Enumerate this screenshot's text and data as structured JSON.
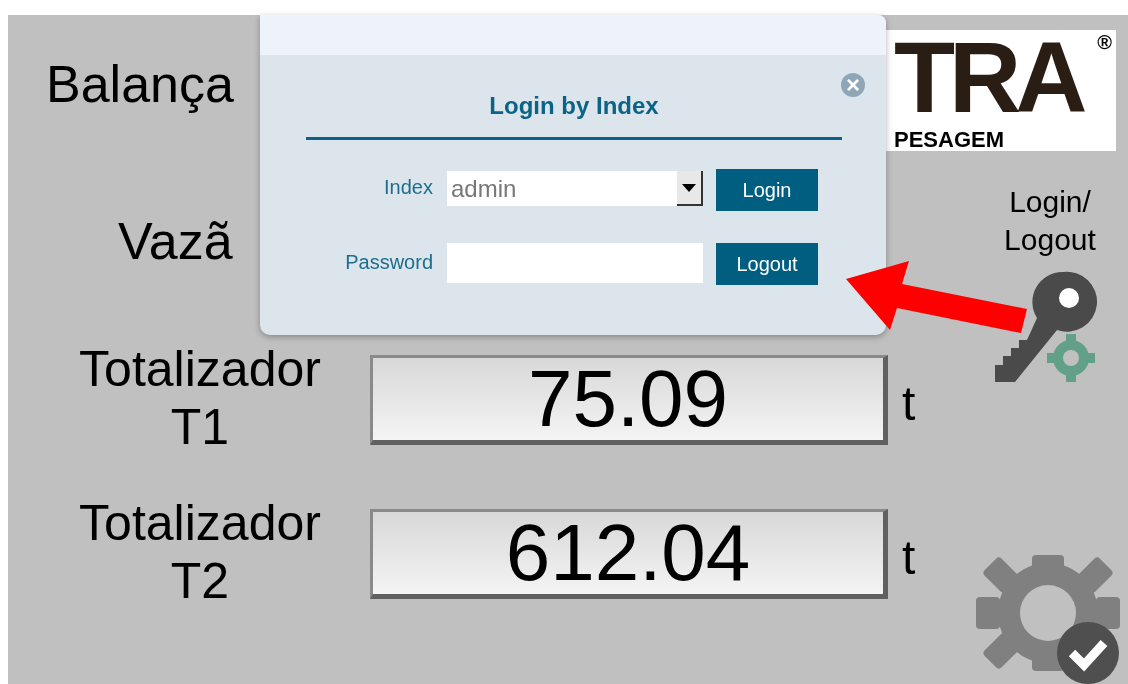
{
  "screen": {
    "title": "Balança",
    "flow_label": "Vazã",
    "totalizers": [
      {
        "label": "Totalizador T1",
        "value": "75.09",
        "unit": "t"
      },
      {
        "label": "Totalizador T2",
        "value": "612.04",
        "unit": "t"
      }
    ],
    "logo": {
      "text": "TRA",
      "registered": "®",
      "subtitle": "PESAGEM"
    },
    "login_logout_label": "Login/ Logout"
  },
  "dialog": {
    "title": "Login by Index",
    "close": "×",
    "index": {
      "label": "Index",
      "value": "admin"
    },
    "password": {
      "label": "Password"
    },
    "buttons": [
      "Login",
      "Logout"
    ]
  }
}
